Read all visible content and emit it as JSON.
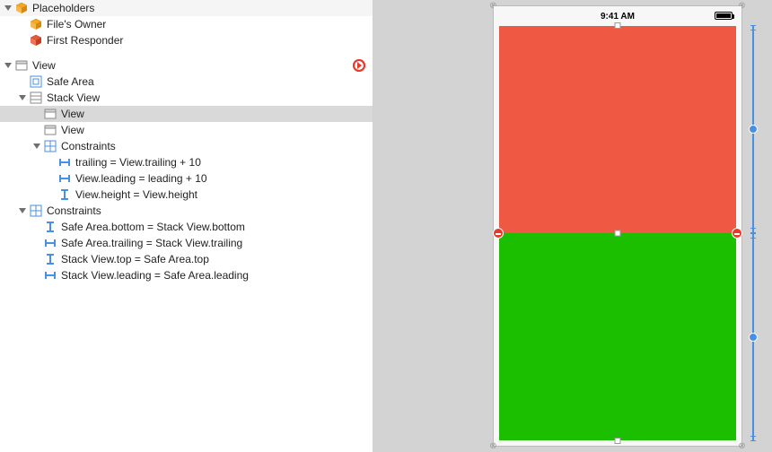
{
  "outline": {
    "placeholders": {
      "label": "Placeholders",
      "children": {
        "filesOwner": "File's Owner",
        "firstResponder": "First Responder"
      }
    },
    "rootView": {
      "label": "View",
      "hasError": true,
      "safeArea": "Safe Area",
      "stackView": {
        "label": "Stack View",
        "children": {
          "view1": "View",
          "view2": "View"
        },
        "constraints": {
          "label": "Constraints",
          "items": [
            "trailing = View.trailing + 10",
            "View.leading = leading + 10",
            "View.height = View.height"
          ]
        }
      },
      "constraints": {
        "label": "Constraints",
        "items": [
          "Safe Area.bottom = Stack View.bottom",
          "Safe Area.trailing = Stack View.trailing",
          "Stack View.top = Safe Area.top",
          "Stack View.leading = Safe Area.leading"
        ]
      }
    }
  },
  "canvas": {
    "time": "9:41 AM",
    "colors": {
      "topView": "#ef5944",
      "bottomView": "#1bbf00",
      "canvasBg": "#d3d3d3"
    }
  },
  "icons": {
    "cube": "cube-icon",
    "view": "view-icon",
    "stack": "stack-icon",
    "constraints": "constraints-icon",
    "constraint": "constraint-icon",
    "safeArea": "safe-area-icon"
  }
}
